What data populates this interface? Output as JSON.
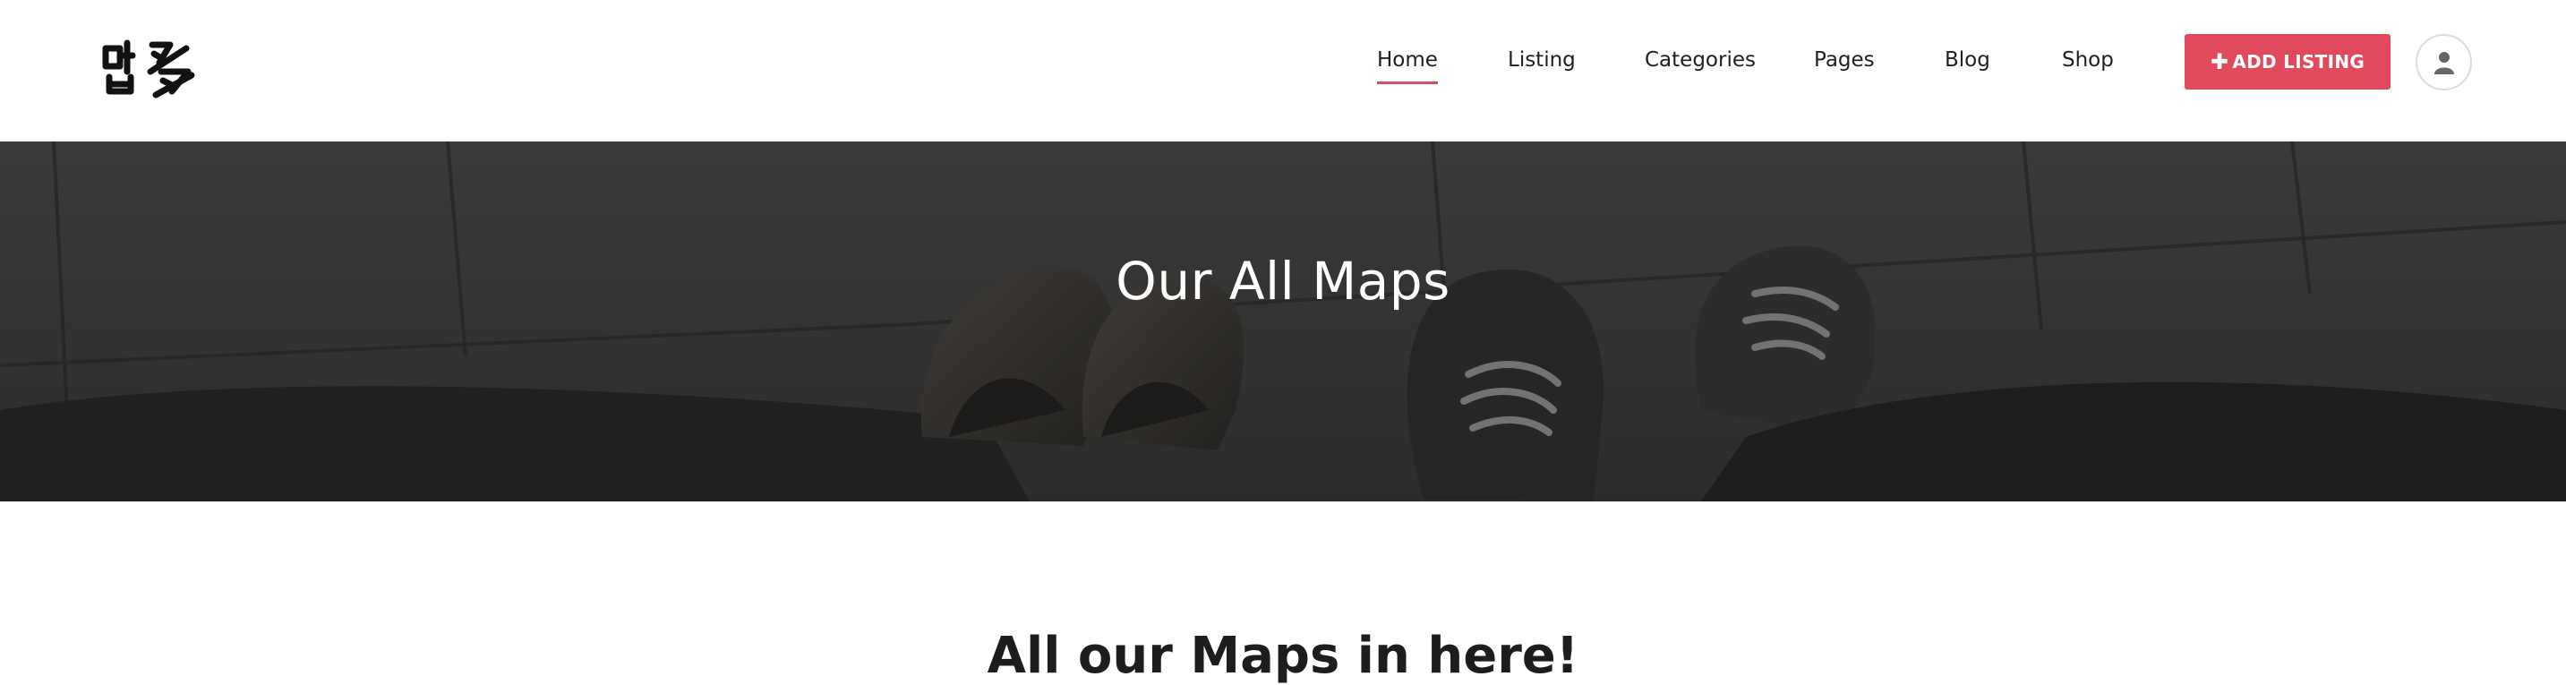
{
  "header": {
    "logo_text": "맵多",
    "nav": [
      {
        "label": "Home",
        "active": true
      },
      {
        "label": "Listing",
        "active": false
      },
      {
        "label": "Categories",
        "active": false
      },
      {
        "label": "Pages",
        "active": false
      },
      {
        "label": "Blog",
        "active": false
      },
      {
        "label": "Shop",
        "active": false
      }
    ],
    "add_listing_label": "ADD LISTING",
    "add_listing_icon": "plus-icon",
    "user_icon": "user-icon"
  },
  "hero": {
    "title": "Our All Maps",
    "background": "photo-of-shoes-on-tiled-floor"
  },
  "section": {
    "title": "All our Maps in here!"
  },
  "colors": {
    "accent": "#e04a5c",
    "nav_underline": "#e0495b",
    "hero_overlay": "#1e1e1e"
  }
}
